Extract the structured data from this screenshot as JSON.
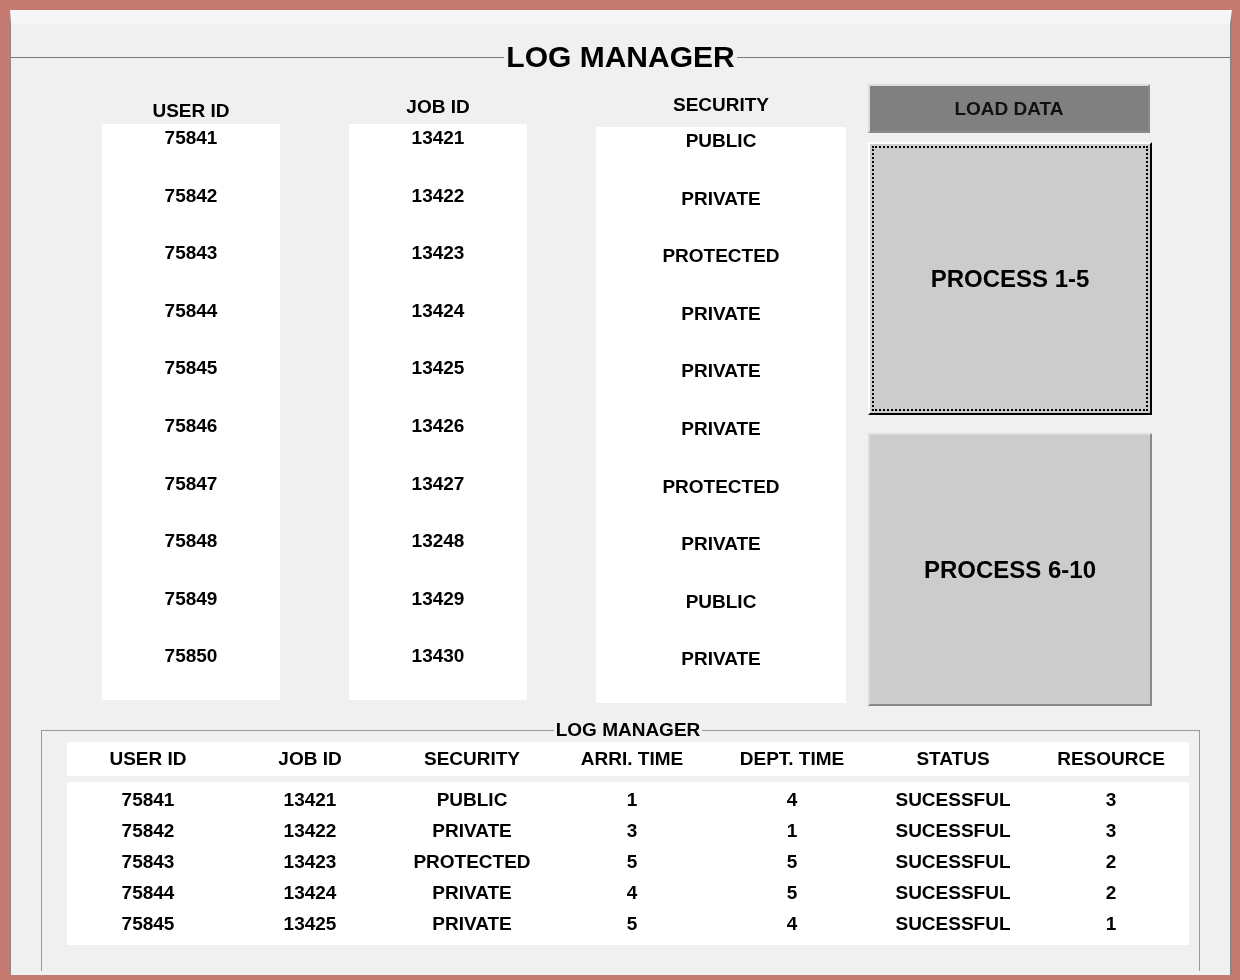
{
  "panel": {
    "title": "LOG MANAGER"
  },
  "lists": [
    {
      "header": "USER ID",
      "items": [
        "75841",
        "75842",
        "75843",
        "75844",
        "75845",
        "75846",
        "75847",
        "75848",
        "75849",
        "75850"
      ]
    },
    {
      "header": "JOB ID",
      "items": [
        "13421",
        "13422",
        "13423",
        "13424",
        "13425",
        "13426",
        "13427",
        "13248",
        "13429",
        "13430"
      ]
    },
    {
      "header": "SECURITY",
      "items": [
        "PUBLIC",
        "PRIVATE",
        "PROTECTED",
        "PRIVATE",
        "PRIVATE",
        "PRIVATE",
        "PROTECTED",
        "PRIVATE",
        "PUBLIC",
        "PRIVATE"
      ]
    }
  ],
  "buttons": [
    {
      "label": "LOAD DATA",
      "kind": "dark",
      "focused": false
    },
    {
      "label": "PROCESS 1-5",
      "kind": "large",
      "focused": true
    },
    {
      "label": "PROCESS 6-10",
      "kind": "large",
      "focused": false
    }
  ],
  "table": {
    "title": "LOG MANAGER",
    "columns": [
      "USER ID",
      "JOB ID",
      "SECURITY",
      "ARRI. TIME",
      "DEPT. TIME",
      "STATUS",
      "RESOURCE"
    ],
    "rows": [
      [
        "75841",
        "13421",
        "PUBLIC",
        "1",
        "4",
        "SUCESSFUL",
        "3"
      ],
      [
        "75842",
        "13422",
        "PRIVATE",
        "3",
        "1",
        "SUCESSFUL",
        "3"
      ],
      [
        "75843",
        "13423",
        "PROTECTED",
        "5",
        "5",
        "SUCESSFUL",
        "2"
      ],
      [
        "75844",
        "13424",
        "PRIVATE",
        "4",
        "5",
        "SUCESSFUL",
        "2"
      ],
      [
        "75845",
        "13425",
        "PRIVATE",
        "5",
        "4",
        "SUCESSFUL",
        "1"
      ]
    ]
  }
}
